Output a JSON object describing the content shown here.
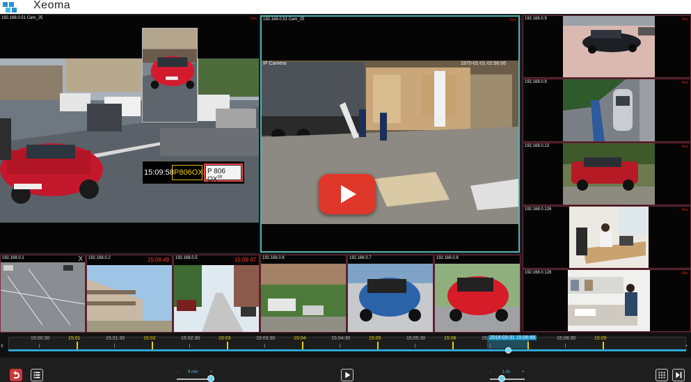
{
  "app": {
    "title": "Xeoma"
  },
  "cameras": {
    "main_left": {
      "label": "192.168.0.51 Cam_25",
      "rec": "Rec"
    },
    "main_center": {
      "label": "192.168.0.51 Cam_25",
      "rec": "Rec",
      "overlay_label": "IP Camera",
      "overlay_date": "1970-01-01 02:56:06"
    },
    "right": [
      {
        "label": "192.168.0.9",
        "rec": "Rec"
      },
      {
        "label": "192.168.0.9",
        "rec": "Rec"
      },
      {
        "label": "192.168.0.13",
        "rec": "Rec"
      },
      {
        "label": "192.168.0.126",
        "rec": "Rec"
      },
      {
        "label": "192.168.0.128",
        "rec": "Rec"
      }
    ],
    "bottom": [
      {
        "label": "192.168.0.1",
        "time": "",
        "close": "X"
      },
      {
        "label": "192.168.0.2",
        "time": "15:09:49",
        "close": ""
      },
      {
        "label": "192.168.0.5",
        "time": "15:09:47",
        "close": ""
      },
      {
        "label": "192.168.0.6",
        "time": "",
        "close": ""
      },
      {
        "label": "192.168.0.7",
        "time": "",
        "close": ""
      },
      {
        "label": "192.168.0.8",
        "time": "",
        "close": ""
      }
    ]
  },
  "plate_recognition": {
    "time": "15:09:58",
    "number": "P806OX39",
    "plate_image_text": "P 806 OX",
    "plate_region": "39"
  },
  "timeline": {
    "labels": [
      {
        "text": "15:00:30",
        "color": "grey"
      },
      {
        "text": "15:01",
        "color": "yellow"
      },
      {
        "text": "15:01:30",
        "color": "grey"
      },
      {
        "text": "15:02",
        "color": "yellow"
      },
      {
        "text": "15:02:30",
        "color": "grey"
      },
      {
        "text": "15:03",
        "color": "yellow"
      },
      {
        "text": "15:03:30",
        "color": "grey"
      },
      {
        "text": "15:04",
        "color": "yellow"
      },
      {
        "text": "15:04:30",
        "color": "grey"
      },
      {
        "text": "15:05",
        "color": "yellow"
      },
      {
        "text": "15:05:30",
        "color": "grey"
      },
      {
        "text": "15:06",
        "color": "yellow"
      },
      {
        "text": "15:07:30",
        "color": "grey"
      },
      {
        "text": "15:08",
        "color": "yellow"
      },
      {
        "text": "15:08:30",
        "color": "grey"
      },
      {
        "text": "15:09",
        "color": "yellow"
      }
    ],
    "cursor_label": "2016-03-31 15:06:48",
    "left_arrow": "‹",
    "right_arrow": "›"
  },
  "controls": {
    "interval_slider": {
      "label": "9 min",
      "min_mark": "-",
      "max_mark": "+"
    },
    "speed_slider": {
      "label": "1.0x",
      "min_mark": "-",
      "max_mark": "+"
    }
  },
  "colors": {
    "accent": "#4fb3b0",
    "timeline_blue": "#2aa6d0",
    "rec_red": "#e02020",
    "tick_yellow": "#e6d200",
    "play_red": "#e0372b"
  },
  "icons": {
    "logo": "xeoma-logo-icon",
    "undo": "undo-icon",
    "list": "list-icon",
    "play": "play-icon",
    "grid": "grid-icon",
    "next": "skip-next-icon"
  }
}
